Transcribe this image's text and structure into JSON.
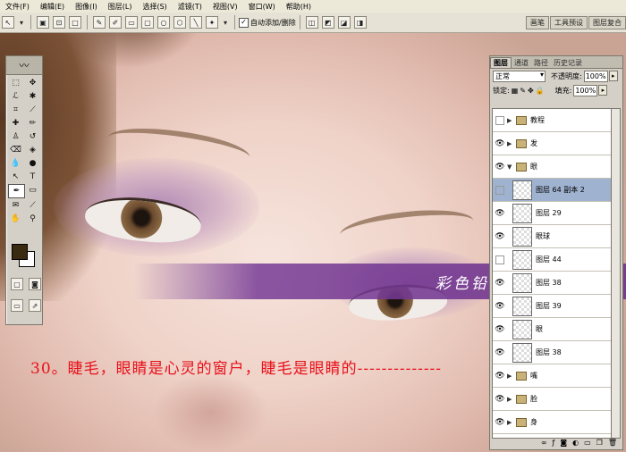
{
  "menu": [
    "文件(F)",
    "编辑(E)",
    "图像(I)",
    "图层(L)",
    "选择(S)",
    "滤镜(T)",
    "视图(V)",
    "窗口(W)",
    "帮助(H)"
  ],
  "options": {
    "auto_add_label": "自动添加/删除",
    "auto_add_checked": true
  },
  "top_tabs": [
    "画笔",
    "工具预设",
    "图层复合"
  ],
  "canvas": {
    "watermark": "彩色铅笔-猜 原创教程",
    "caption": "30。睫毛，眼睛是心灵的窗户，睫毛是眼睛的--------------"
  },
  "layers_panel": {
    "tabs": [
      "图层",
      "通道",
      "路径",
      "历史记录"
    ],
    "blend_mode": "正常",
    "opacity_label": "不透明度:",
    "opacity_value": "100%",
    "lock_label": "锁定:",
    "fill_label": "填充:",
    "fill_value": "100%",
    "layers": [
      {
        "name": "教程",
        "type": "folder",
        "visible": false,
        "expanded": false,
        "selected": false
      },
      {
        "name": "发",
        "type": "folder",
        "visible": true,
        "expanded": false,
        "selected": false
      },
      {
        "name": "眼",
        "type": "folder",
        "visible": true,
        "expanded": true,
        "selected": false
      },
      {
        "name": "图层 64 副本 2",
        "type": "layer",
        "visible": false,
        "selected": true
      },
      {
        "name": "图层 29",
        "type": "layer",
        "visible": true,
        "selected": false
      },
      {
        "name": "眼球",
        "type": "layer",
        "visible": true,
        "selected": false
      },
      {
        "name": "图层 44",
        "type": "layer",
        "visible": false,
        "selected": false
      },
      {
        "name": "图层 38",
        "type": "layer",
        "visible": true,
        "selected": false
      },
      {
        "name": "图层 39",
        "type": "layer",
        "visible": true,
        "selected": false
      },
      {
        "name": "眼",
        "type": "layer",
        "visible": true,
        "selected": false
      },
      {
        "name": "图层 38",
        "type": "layer",
        "visible": true,
        "selected": false
      },
      {
        "name": "嘴",
        "type": "folder",
        "visible": true,
        "expanded": false,
        "selected": false
      },
      {
        "name": "脸",
        "type": "folder",
        "visible": true,
        "expanded": false,
        "selected": false
      },
      {
        "name": "身",
        "type": "folder",
        "visible": true,
        "expanded": false,
        "selected": false
      }
    ]
  },
  "colors": {
    "caption": "#e8101a",
    "band": "#7a3c96",
    "selected_layer": "#9fb2d0"
  }
}
